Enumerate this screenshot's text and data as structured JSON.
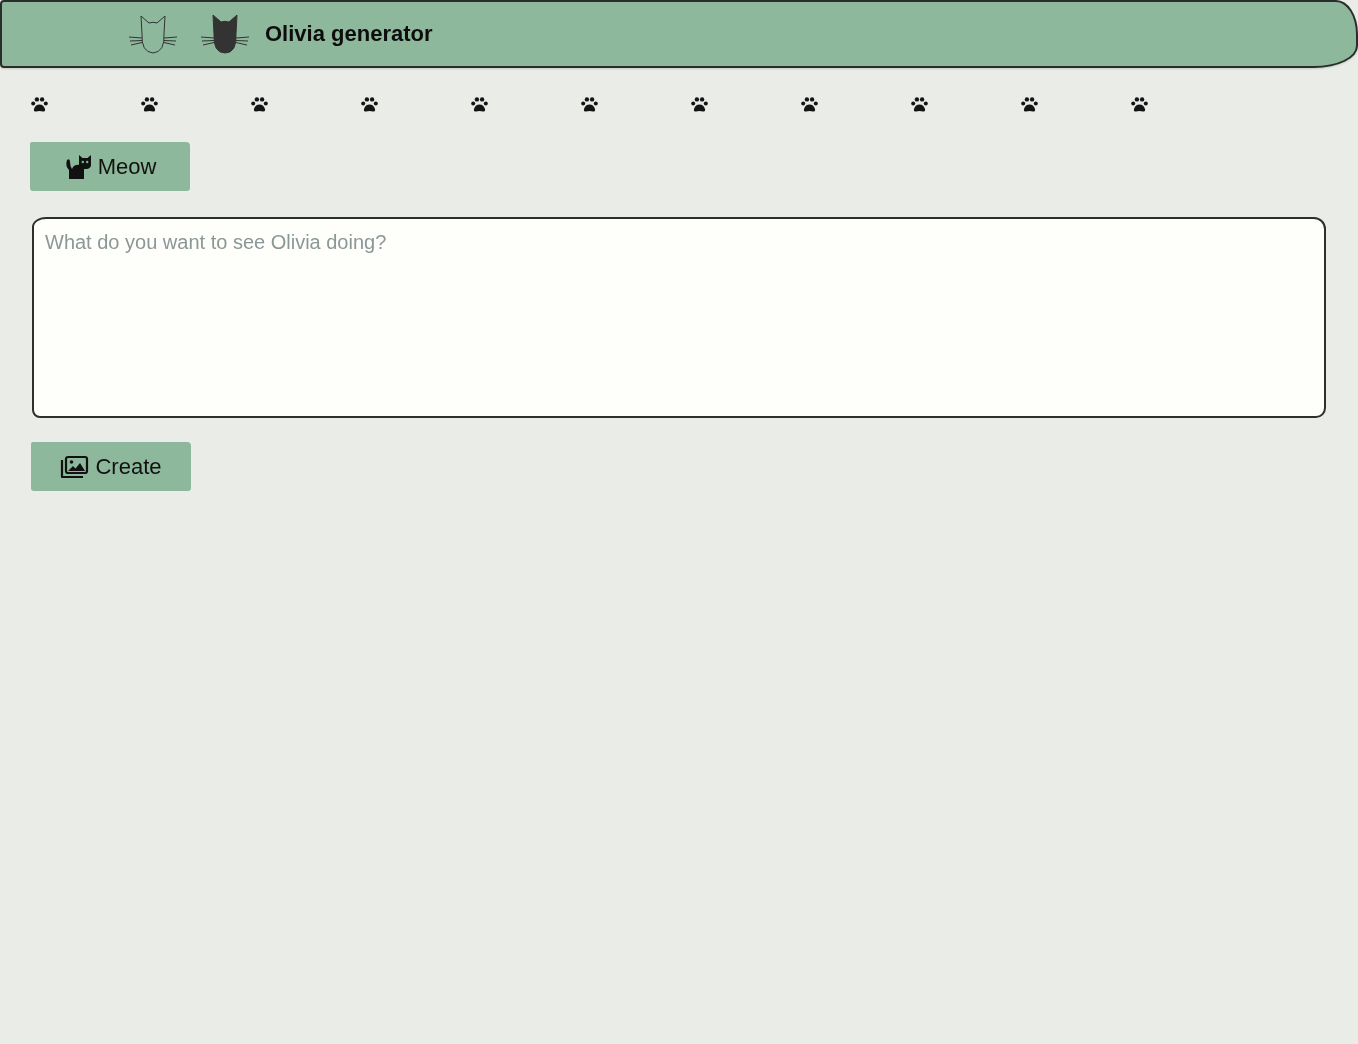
{
  "header": {
    "title": "Olivia generator"
  },
  "meow_button": {
    "label": "Meow"
  },
  "prompt": {
    "placeholder": "What do you want to see Olivia doing?"
  },
  "create_button": {
    "label": "Create"
  }
}
